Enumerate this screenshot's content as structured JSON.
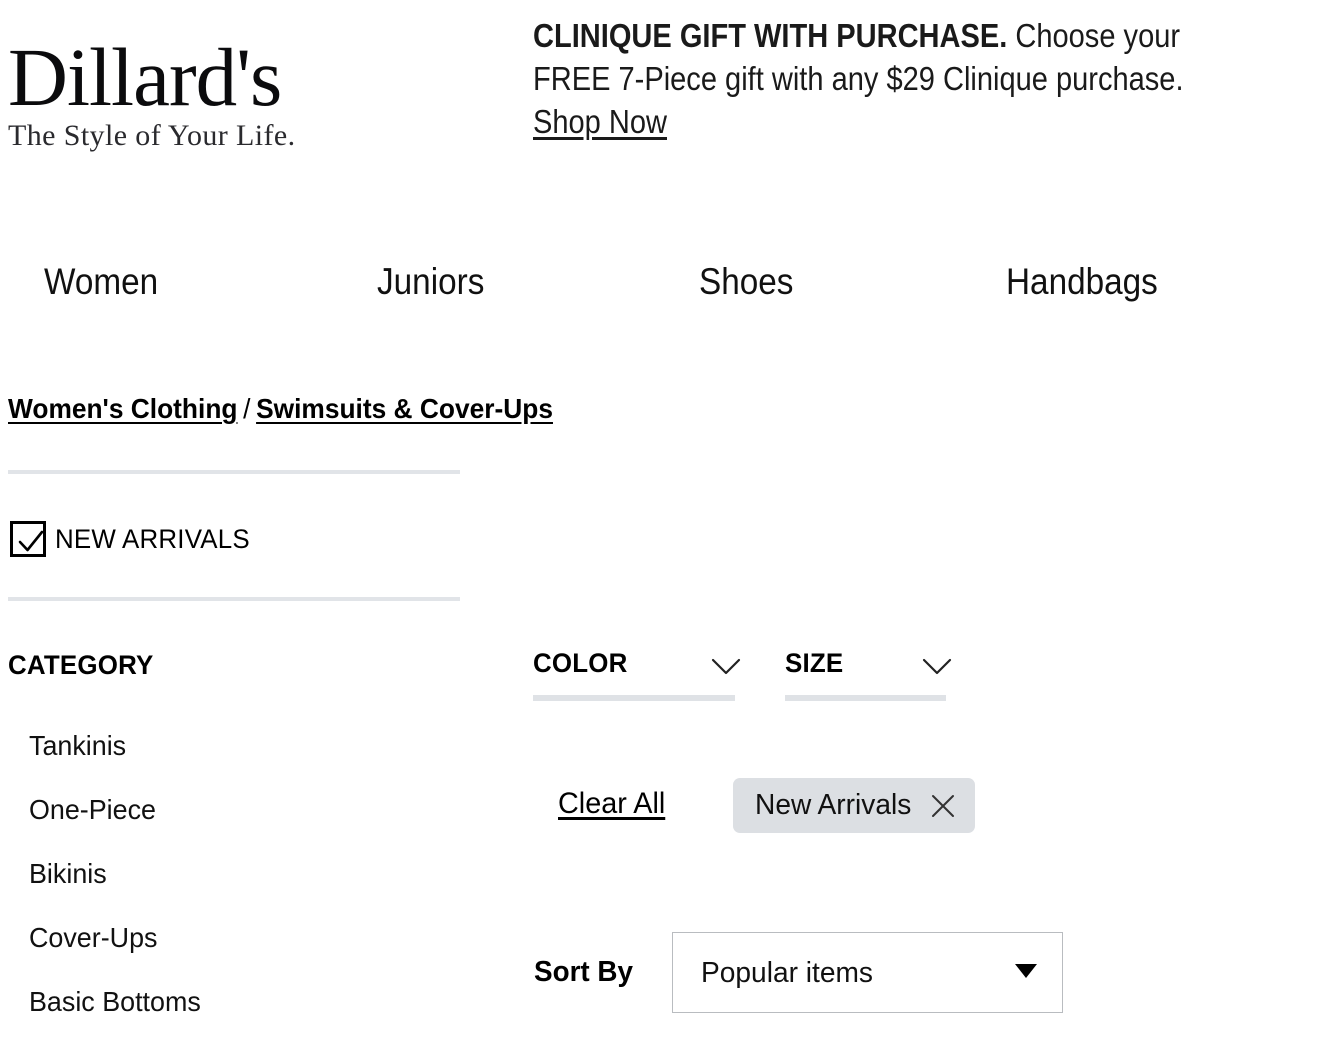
{
  "brand": {
    "name": "Dillard's",
    "tagline": "The Style of Your Life."
  },
  "promo": {
    "headline": "CLINIQUE GIFT WITH PURCHASE.",
    "body_line1": " Choose your",
    "body_line2": "FREE 7-Piece gift with any $29 Clinique purchase.",
    "link_label": "Shop Now"
  },
  "nav": {
    "items": [
      {
        "label": "Women"
      },
      {
        "label": "Juniors"
      },
      {
        "label": "Shoes"
      },
      {
        "label": "Handbags"
      }
    ]
  },
  "breadcrumb": {
    "items": [
      {
        "label": "Women's Clothing"
      },
      {
        "label": "Swimsuits & Cover-Ups"
      }
    ],
    "separator": "/"
  },
  "filters": {
    "new_arrivals": {
      "label": "NEW ARRIVALS",
      "checked": true,
      "icon": "checkmark-icon"
    },
    "category": {
      "title": "CATEGORY",
      "items": [
        {
          "label": "Tankinis"
        },
        {
          "label": "One-Piece"
        },
        {
          "label": "Bikinis"
        },
        {
          "label": "Cover-Ups"
        },
        {
          "label": "Basic Bottoms"
        }
      ]
    },
    "dropdowns": [
      {
        "label": "COLOR",
        "icon": "chevron-down-icon"
      },
      {
        "label": "SIZE",
        "icon": "chevron-down-icon"
      }
    ],
    "clear_all_label": "Clear All",
    "active_chips": [
      {
        "label": "New Arrivals",
        "remove_icon": "close-icon"
      }
    ]
  },
  "sort": {
    "label": "Sort By",
    "selected": "Popular items",
    "arrow_icon": "caret-down-icon"
  },
  "colors": {
    "text": "#111111",
    "divider": "#e1e4e8",
    "filter_bar": "#dfe2e6",
    "chip_background": "#dcdfe3",
    "select_border": "#b9bcc0"
  }
}
